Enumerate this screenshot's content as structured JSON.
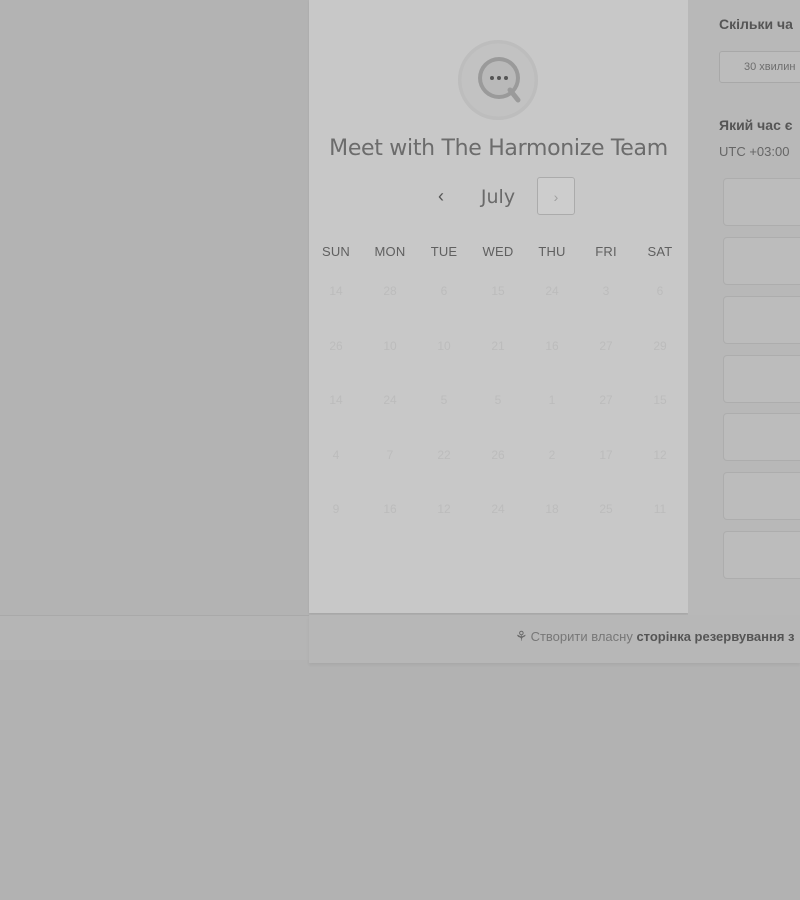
{
  "title": "Meet with The Harmonize Team",
  "calendar": {
    "prev_icon": "‹",
    "next_icon": "›",
    "month": "July",
    "weekdays": [
      "SUN",
      "MON",
      "TUE",
      "WED",
      "THU",
      "FRI",
      "SAT"
    ],
    "weeks": [
      [
        "14",
        "28",
        "6",
        "15",
        "24",
        "3",
        "6"
      ],
      [
        "26",
        "10",
        "10",
        "21",
        "16",
        "27",
        "29"
      ],
      [
        "14",
        "24",
        "5",
        "5",
        "1",
        "27",
        "15"
      ],
      [
        "4",
        "7",
        "22",
        "26",
        "2",
        "17",
        "12"
      ],
      [
        "9",
        "16",
        "12",
        "24",
        "18",
        "25",
        "11"
      ]
    ]
  },
  "right": {
    "duration_label": "Скільки ча",
    "duration_value": "30 хвилин",
    "time_label": "Який час є",
    "timezone": "UTC +03:00 "
  },
  "footer": {
    "icon": "sprocket-icon",
    "text": "Створити власну ",
    "bold": "сторінка резервування з"
  },
  "colors": {
    "overlay": "#b2b2b2",
    "card": "#c8c8c8"
  }
}
